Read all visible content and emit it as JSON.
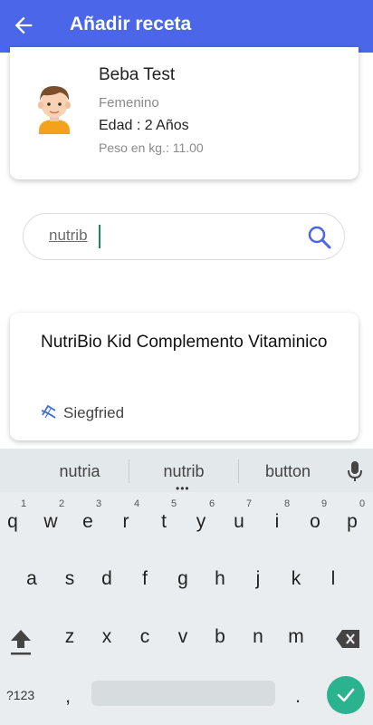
{
  "app_bar": {
    "title": "Añadir receta",
    "color": "#4b66e8"
  },
  "patient": {
    "name": "Beba Test",
    "sex": "Femenino",
    "age": "Edad : 2 Años",
    "weight": "Peso en kg.: 11.00"
  },
  "search": {
    "query": "nutrib"
  },
  "result": {
    "title": "NutriBio Kid Complemento Vitaminico",
    "brand": "Siegfried"
  },
  "keyboard": {
    "suggestions": [
      "nutria",
      "nutrib",
      "button"
    ],
    "row1": [
      "q",
      "w",
      "e",
      "r",
      "t",
      "y",
      "u",
      "i",
      "o",
      "p"
    ],
    "row1_numbers": [
      "1",
      "2",
      "3",
      "4",
      "5",
      "6",
      "7",
      "8",
      "9",
      "0"
    ],
    "row2": [
      "a",
      "s",
      "d",
      "f",
      "g",
      "h",
      "j",
      "k",
      "l"
    ],
    "row3": [
      "z",
      "x",
      "c",
      "v",
      "b",
      "n",
      "m"
    ],
    "symbols_key": "?123",
    "comma": ",",
    "period": ".",
    "accent_color": "#2bb28e"
  }
}
